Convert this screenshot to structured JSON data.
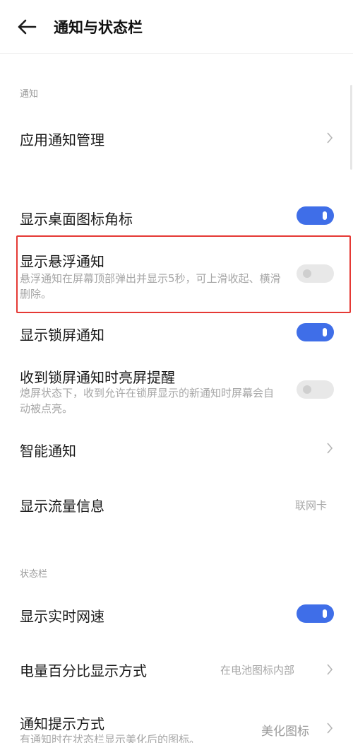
{
  "header": {
    "title": "通知与状态栏",
    "back_icon": "arrow-left-icon"
  },
  "sections": {
    "notification_label": "通知",
    "statusbar_label": "状态栏"
  },
  "rows": {
    "app_notification": {
      "title": "应用通知管理"
    },
    "desktop_badge": {
      "title": "显示桌面图标角标",
      "toggle": "on"
    },
    "floating": {
      "title": "显示悬浮通知",
      "desc": "悬浮通知在屏幕顶部弹出并显示5秒，可上滑收起、横滑删除。",
      "toggle": "off"
    },
    "lockscreen": {
      "title": "显示锁屏通知",
      "toggle": "on"
    },
    "wake_screen": {
      "title": "收到锁屏通知时亮屏提醒",
      "desc": "熄屏状态下，收到允许在锁屏显示的新通知时屏幕会自动被点亮。",
      "toggle": "off"
    },
    "smart": {
      "title": "智能通知"
    },
    "traffic": {
      "title": "显示流量信息",
      "value": "联网卡"
    },
    "network_speed": {
      "title": "显示实时网速",
      "toggle": "on"
    },
    "battery": {
      "title": "电量百分比显示方式",
      "value": "在电池图标内部"
    },
    "notify_style": {
      "title": "通知提示方式",
      "desc": "有通知时在状态栏显示美化后的图标。",
      "value": "美化图标"
    }
  },
  "colors": {
    "accent": "#3f6ee8",
    "highlight": "#e53935"
  }
}
